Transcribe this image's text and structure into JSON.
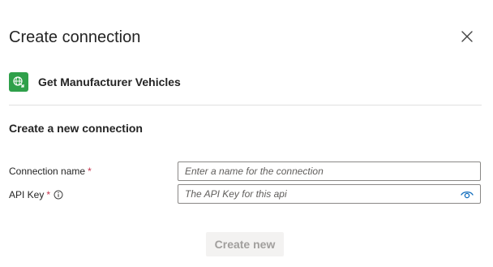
{
  "dialog": {
    "title": "Create connection",
    "close_icon": "close-icon"
  },
  "connector": {
    "name": "Get Manufacturer Vehicles",
    "icon": "globe-icon",
    "icon_color": "#2fa04a"
  },
  "form": {
    "heading": "Create a new connection",
    "fields": [
      {
        "label": "Connection name",
        "required": true,
        "required_marker": "*",
        "placeholder": "Enter a name for the connection",
        "value": ""
      },
      {
        "label": "API Key",
        "required": true,
        "required_marker": "*",
        "info_icon": "info-icon",
        "placeholder": "The API Key for this api",
        "value": "",
        "reveal_icon": "eye-icon"
      }
    ],
    "submit_label": "Create new"
  },
  "colors": {
    "required": "#c4314b",
    "accent": "#0f6cbd",
    "disabled_bg": "#f3f2f1",
    "disabled_text": "#a19f9d"
  }
}
